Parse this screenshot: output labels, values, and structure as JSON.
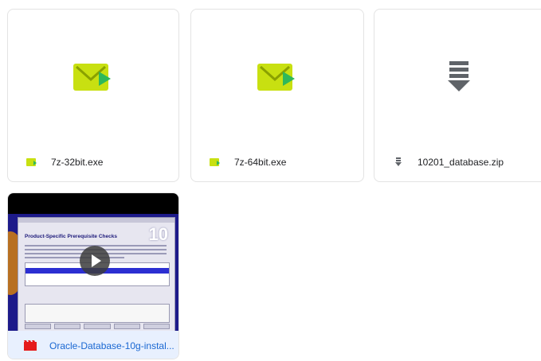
{
  "files": [
    {
      "name": "7z-32bit.exe",
      "icon": "exe-icon"
    },
    {
      "name": "7z-64bit.exe",
      "icon": "exe-icon"
    },
    {
      "name": "10201_database.zip",
      "icon": "zip-icon"
    }
  ],
  "video": {
    "name": "Oracle-Database-10g-instal...",
    "icon": "video-icon",
    "thumbnail": {
      "heading": "Product-Specific Prerequisite Checks",
      "logo": "10"
    }
  },
  "colors": {
    "exe_green": "#c8e011",
    "exe_arrow": "#2fb85a",
    "zip_gray": "#5f6368",
    "video_red": "#e51b1b",
    "selected_bg": "#e8f0fe",
    "selected_text": "#1967d2"
  }
}
